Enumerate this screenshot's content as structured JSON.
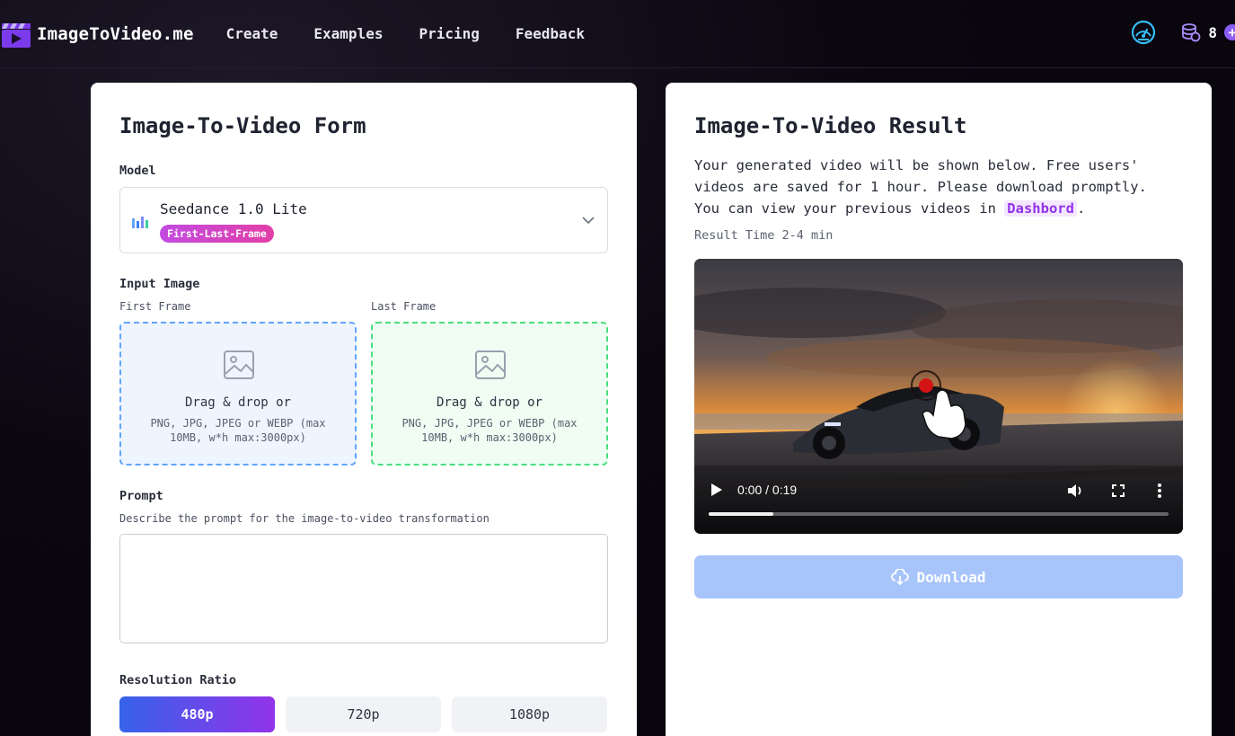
{
  "nav": {
    "brand": "ImageToVideo.me",
    "links": [
      "Create",
      "Examples",
      "Pricing",
      "Feedback"
    ],
    "credits": "8",
    "plus": "+"
  },
  "form": {
    "title": "Image-To-Video Form",
    "model_label": "Model",
    "model_name": "Seedance 1.0 Lite",
    "model_badge": "First-Last-Frame",
    "input_label": "Input Image",
    "first_frame_label": "First Frame",
    "last_frame_label": "Last Frame",
    "drop_title": "Drag & drop or",
    "drop_hint": "PNG, JPG, JPEG or WEBP (max 10MB, w*h max:3000px)",
    "prompt_label": "Prompt",
    "prompt_desc": "Describe the prompt for the image-to-video transformation",
    "prompt_value": "",
    "resolution_label": "Resolution Ratio",
    "resolutions": [
      "480p",
      "720p",
      "1080p"
    ],
    "selected_resolution": "480p"
  },
  "result": {
    "title": "Image-To-Video Result",
    "desc_before": "Your generated video will be shown below. Free users' videos are saved for 1 hour. Please download promptly. You can view your previous videos in ",
    "dashboard_link": "Dashbord",
    "desc_after": ".",
    "time_note": "Result Time 2-4 min",
    "video_time": "0:00 / 0:19",
    "progress_fraction": 0.14,
    "download_label": "Download"
  },
  "colors": {
    "accent_purple": "#9333ea",
    "accent_blue": "#3563e9",
    "download_disabled": "#a7c4fb"
  }
}
